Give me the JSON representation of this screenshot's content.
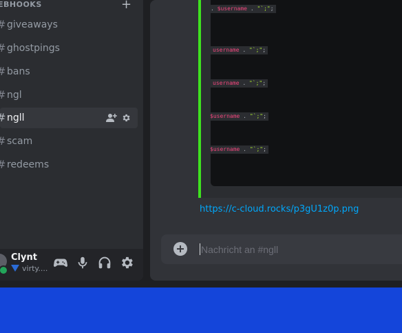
{
  "sidebar": {
    "category": "EBHOOKS",
    "add_icon": "plus-icon",
    "channels": [
      {
        "label": "giveaways"
      },
      {
        "label": "ghostpings"
      },
      {
        "label": "bans"
      },
      {
        "label": "ngl"
      },
      {
        "label": "ngll",
        "active": true
      },
      {
        "label": "scam"
      },
      {
        "label": "redeems"
      }
    ],
    "channel_prefix": "#"
  },
  "user": {
    "name": "Clynt",
    "status": "virty...."
  },
  "chat": {
    "code_lines": [
      {
        "prefix": ". ",
        "var": "$username",
        "op": " . ",
        "str": "\"`;\"",
        "suffix": ";"
      },
      {
        "prefix": "",
        "var": "username",
        "op": " . ",
        "str": "\"`;\"",
        "suffix": ";"
      },
      {
        "prefix": "",
        "var": "username",
        "op": " . ",
        "str": "\"`;\"",
        "suffix": ";"
      },
      {
        "prefix": "",
        "var": "$username",
        "op": " . ",
        "str": "\"`;\"",
        "suffix": ";"
      },
      {
        "prefix": "",
        "var": "$username",
        "op": " . ",
        "str": "\"`;\"",
        "suffix": ";"
      }
    ],
    "link": "https://c-cloud.rocks/p3gU1z0p.png",
    "composer_placeholder": "Nachricht an #ngll"
  },
  "colors": {
    "embed_border": "#3ee21f",
    "link": "#00a8fc",
    "taskbar": "#1445da",
    "online": "#23a55a"
  }
}
